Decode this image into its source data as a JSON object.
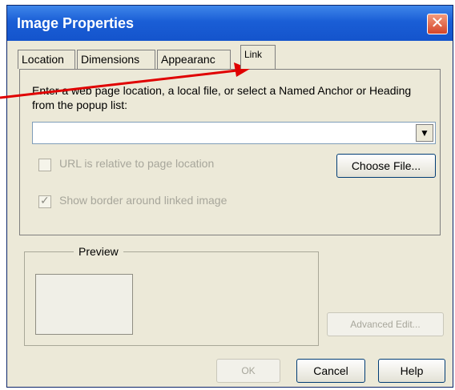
{
  "window": {
    "title": "Image Properties",
    "close_glyph": "✕"
  },
  "tabs": [
    {
      "label": "Location",
      "active": false
    },
    {
      "label": "Dimensions",
      "active": false
    },
    {
      "label": "Appearanc",
      "active": false
    },
    {
      "label": "Link",
      "active": true
    }
  ],
  "link_panel": {
    "instruction": "Enter a web page location, a local file, or select a Named Anchor or Heading from the popup list:",
    "url_value": "",
    "url_relative_label": "URL is relative to page location",
    "url_relative_checked": false,
    "show_border_label": "Show border around linked image",
    "show_border_checked": true,
    "choose_file_label": "Choose File..."
  },
  "preview": {
    "label": "Preview"
  },
  "buttons": {
    "advanced_edit": "Advanced Edit...",
    "ok": "OK",
    "cancel": "Cancel",
    "help": "Help"
  },
  "annotation": {
    "arrow_color": "#e00000"
  }
}
